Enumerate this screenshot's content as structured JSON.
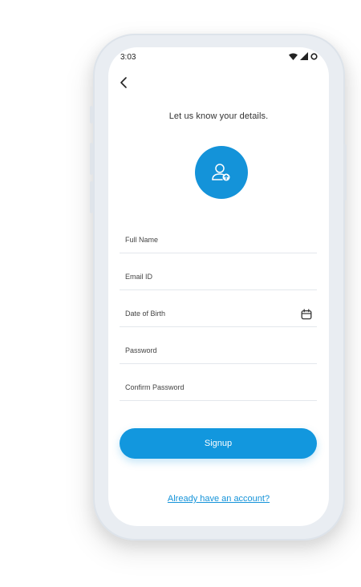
{
  "status": {
    "time": "3:03"
  },
  "page": {
    "title": "Let us know your details."
  },
  "form": {
    "full_name_placeholder": "Full Name",
    "email_placeholder": "Email ID",
    "dob_placeholder": "Date of Birth",
    "password_placeholder": "Password",
    "confirm_password_placeholder": "Confirm Password"
  },
  "actions": {
    "signup_label": "Signup",
    "login_link": "Already have an account?"
  },
  "icons": {
    "back": "back-arrow-icon",
    "avatar": "user-upload-icon",
    "calendar": "calendar-icon",
    "wifi": "wifi-icon",
    "signal": "signal-icon",
    "battery": "battery-icon"
  },
  "colors": {
    "accent": "#1493d9",
    "button": "#1297de",
    "divider": "#e3e7ec",
    "frame": "#e9edf2"
  }
}
